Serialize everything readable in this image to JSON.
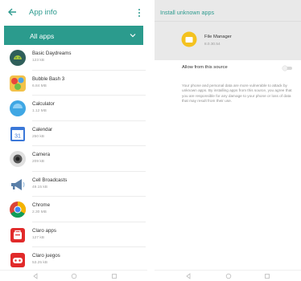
{
  "left_screen": {
    "header": {
      "title": "App info"
    },
    "filter": {
      "label": "All apps"
    },
    "apps": [
      {
        "name": "Basic Daydreams",
        "size": "123 kB",
        "icon": "android-icon"
      },
      {
        "name": "Bubble Bash 3",
        "size": "6.84 MB",
        "icon": "bubble-bash-icon"
      },
      {
        "name": "Calculator",
        "size": "1.12 MB",
        "icon": "calculator-icon"
      },
      {
        "name": "Calendar",
        "size": "250 kB",
        "icon": "calendar-icon"
      },
      {
        "name": "Camera",
        "size": "209 kB",
        "icon": "camera-icon"
      },
      {
        "name": "Cell Broadcasts",
        "size": "49.15 kB",
        "icon": "megaphone-icon"
      },
      {
        "name": "Chrome",
        "size": "2.30 MB",
        "icon": "chrome-icon"
      },
      {
        "name": "Claro apps",
        "size": "127 kB",
        "icon": "claro-apps-icon"
      },
      {
        "name": "Claro juegos",
        "size": "53.25 kB",
        "icon": "claro-juegos-icon"
      }
    ],
    "calendar_icon_text": "31"
  },
  "right_screen": {
    "header": {
      "title": "Install unknown apps"
    },
    "app": {
      "name": "File Manager",
      "version": "8.0.30.54",
      "icon": "file-manager-icon"
    },
    "allow_label": "Allow from this source",
    "allow_enabled": false,
    "info_text": "Your phone and personal data are more vulnerable to attack by unknown apps. By installing apps from this source, you agree that you are responsible for any damage to your phone or loss of data that may result from their use."
  },
  "colors": {
    "accent": "#2b9b8d",
    "header_gray": "#e9e9e9"
  }
}
